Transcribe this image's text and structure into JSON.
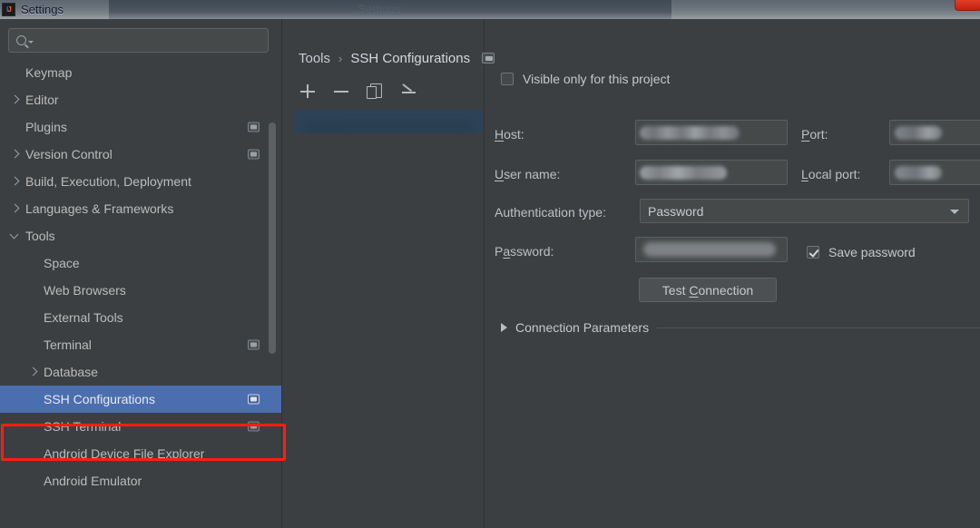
{
  "window": {
    "title": "Settings",
    "icon": "intellij-idea-icon",
    "background_ghost_text": "Settings",
    "close_label": "×"
  },
  "sidebar": {
    "search": {
      "placeholder": "",
      "value": "",
      "icon": "search-icon",
      "dropdown_icon": "chevron-down-icon"
    },
    "items": [
      {
        "label": "Keymap",
        "level": 0,
        "twisty": "none",
        "scope_icon": false,
        "selected": false
      },
      {
        "label": "Editor",
        "level": 0,
        "twisty": "right",
        "scope_icon": false,
        "selected": false
      },
      {
        "label": "Plugins",
        "level": 0,
        "twisty": "none",
        "scope_icon": true,
        "selected": false
      },
      {
        "label": "Version Control",
        "level": 0,
        "twisty": "right",
        "scope_icon": true,
        "selected": false
      },
      {
        "label": "Build, Execution, Deployment",
        "level": 0,
        "twisty": "right",
        "scope_icon": false,
        "selected": false
      },
      {
        "label": "Languages & Frameworks",
        "level": 0,
        "twisty": "right",
        "scope_icon": false,
        "selected": false
      },
      {
        "label": "Tools",
        "level": 0,
        "twisty": "down",
        "scope_icon": false,
        "selected": false
      },
      {
        "label": "Space",
        "level": 1,
        "twisty": "none",
        "scope_icon": false,
        "selected": false
      },
      {
        "label": "Web Browsers",
        "level": 1,
        "twisty": "none",
        "scope_icon": false,
        "selected": false
      },
      {
        "label": "External Tools",
        "level": 1,
        "twisty": "none",
        "scope_icon": false,
        "selected": false
      },
      {
        "label": "Terminal",
        "level": 1,
        "twisty": "none",
        "scope_icon": true,
        "selected": false
      },
      {
        "label": "Database",
        "level": 1,
        "twisty": "right",
        "scope_icon": false,
        "selected": false
      },
      {
        "label": "SSH Configurations",
        "level": 1,
        "twisty": "none",
        "scope_icon": true,
        "selected": true
      },
      {
        "label": "SSH Terminal",
        "level": 1,
        "twisty": "none",
        "scope_icon": true,
        "selected": false
      },
      {
        "label": "Android Device File Explorer",
        "level": 1,
        "twisty": "none",
        "scope_icon": false,
        "selected": false
      },
      {
        "label": "Android Emulator",
        "level": 1,
        "twisty": "none",
        "scope_icon": false,
        "selected": false
      }
    ]
  },
  "breadcrumb": {
    "root": "Tools",
    "separator": "›",
    "current": "SSH Configurations",
    "scope_icon": "project-scope-icon"
  },
  "list_toolbar": {
    "add_label": "+",
    "remove_label": "−",
    "copy_label": "copy",
    "edit_label": "edit"
  },
  "config_list": {
    "items": [
      {
        "label": "",
        "redacted": true,
        "selected": true
      }
    ]
  },
  "detail": {
    "visible_only_checkbox": {
      "label": "Visible only for this project",
      "checked": false
    },
    "host": {
      "label": "Host:",
      "mnemonic": "H",
      "value": "",
      "redacted": true
    },
    "port": {
      "label": "Port:",
      "mnemonic": "P",
      "value": "",
      "redacted": true
    },
    "user_name": {
      "label": "User name:",
      "mnemonic": "U",
      "value": "",
      "redacted": true
    },
    "local_port": {
      "label": "Local port:",
      "mnemonic": "L",
      "value": "",
      "redacted": true
    },
    "authentication_type": {
      "label": "Authentication type:",
      "value": "Password",
      "options": [
        "Password"
      ]
    },
    "password": {
      "label": "Password:",
      "mnemonic": "a",
      "value": "",
      "redacted": true
    },
    "save_password": {
      "label": "Save password",
      "checked": true
    },
    "test_connection_button": {
      "label": "Test Connection",
      "mnemonic": "C"
    },
    "connection_parameters": {
      "label": "Connection Parameters",
      "expanded": false
    }
  },
  "colors": {
    "background": "#3c3f41",
    "selection_blue": "#4b6eaf",
    "annotation_red": "#ff1d12",
    "field_background": "#45494a",
    "text": "#bbbbbb"
  }
}
